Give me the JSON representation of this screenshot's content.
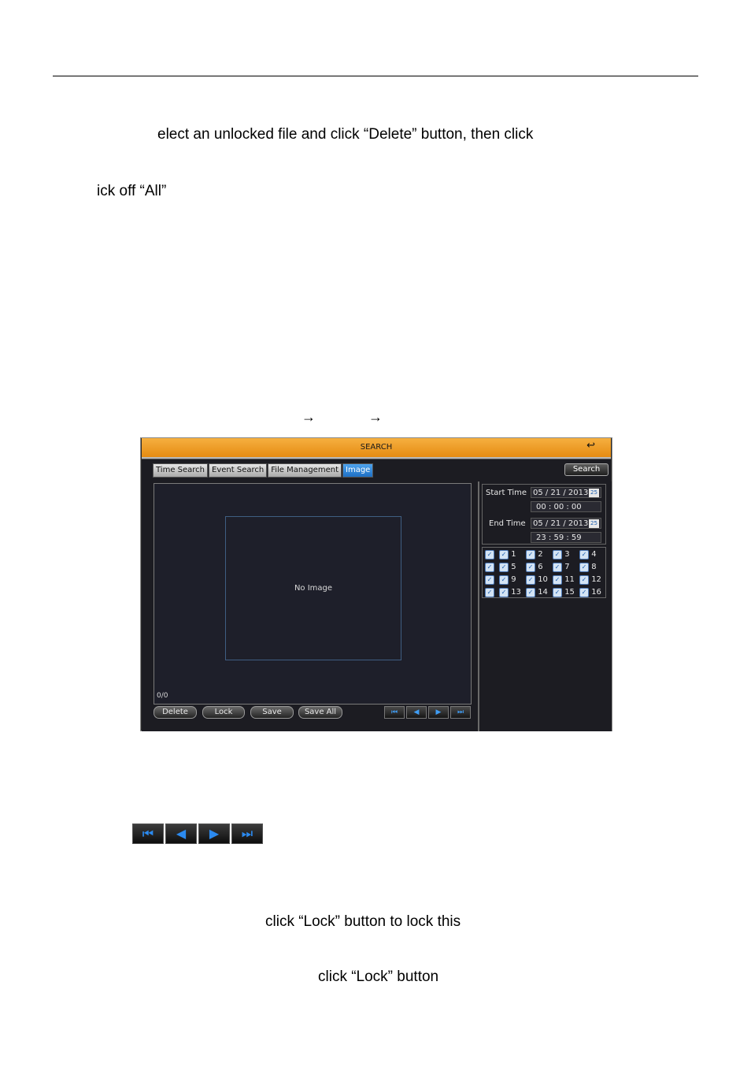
{
  "document": {
    "line1": "elect an unlocked file and click “Delete” button, then click",
    "line2": "ick off “All”",
    "arrow1": "→",
    "arrow2": "→",
    "line3": "click “Lock” button to lock this",
    "line4": "click “Lock” button"
  },
  "dvr": {
    "title": "SEARCH",
    "back_icon": "↩",
    "tabs": [
      "Time Search",
      "Event Search",
      "File Management",
      "Image"
    ],
    "active_tab": "Image",
    "search_button": "Search",
    "no_image": "No Image",
    "counter": "0/0",
    "buttons": {
      "delete": "Delete",
      "lock": "Lock",
      "save": "Save",
      "save_all": "Save All"
    },
    "nav_icons": [
      "first-icon",
      "prev-icon",
      "next-icon",
      "last-icon"
    ],
    "nav_glyphs": [
      "⏮",
      "◀",
      "▶",
      "⏭"
    ],
    "start_label": "Start Time",
    "start_date": "05 / 21 / 2013",
    "start_time": "00 : 00 : 00",
    "end_label": "End Time",
    "end_date": "05 / 21 / 2013",
    "end_time": "23 : 59 : 59",
    "calendar_glyph": "25",
    "channels": [
      "1",
      "2",
      "3",
      "4",
      "5",
      "6",
      "7",
      "8",
      "9",
      "10",
      "11",
      "12",
      "13",
      "14",
      "15",
      "16"
    ]
  },
  "icon_strip": [
    "first-icon",
    "prev-icon",
    "next-icon",
    "last-icon"
  ],
  "icon_strip_glyphs": [
    "⏮",
    "◀",
    "▶",
    "⏭"
  ]
}
